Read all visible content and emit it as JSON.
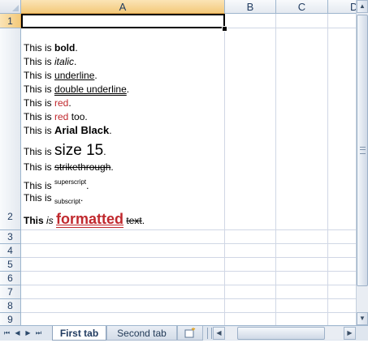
{
  "columns": [
    "A",
    "B",
    "C",
    "D"
  ],
  "rows": [
    "1",
    "2",
    "3",
    "4",
    "5",
    "6",
    "7",
    "8",
    "9"
  ],
  "cell_a2": {
    "line1": {
      "prefix": "This is ",
      "styled": "bold",
      "suffix": "."
    },
    "line2": {
      "prefix": "This is ",
      "styled": "italic",
      "suffix": "."
    },
    "line3": {
      "prefix": "This is ",
      "styled": "underline",
      "suffix": "."
    },
    "line4": {
      "prefix": "This is ",
      "styled": "double underline",
      "suffix": "."
    },
    "line5": {
      "prefix": "This is ",
      "styled": "red",
      "suffix": "."
    },
    "line6": {
      "prefix": "This is ",
      "styled": "red",
      "suffix": " too."
    },
    "line7": {
      "prefix": "This is ",
      "styled": "Arial Black",
      "suffix": "."
    },
    "line8": {
      "prefix": "This is ",
      "styled": "size 15",
      "suffix": "."
    },
    "line9": {
      "prefix": "This is ",
      "styled": "strikethrough",
      "suffix": "."
    },
    "line10": {
      "prefix": "This is ",
      "styled": "superscript",
      "suffix": "."
    },
    "line11": {
      "prefix": "This is ",
      "styled": "subscript",
      "suffix": "."
    },
    "line12": {
      "w1": "This",
      "w2": "is",
      "w3": "formatted",
      "w4": "text",
      "suffix": "."
    }
  },
  "tabs": [
    "First tab",
    "Second tab"
  ],
  "colors": {
    "red_text": "#c0282d",
    "grid": "#d0d7e5",
    "header_selected": "#f3c97a"
  }
}
